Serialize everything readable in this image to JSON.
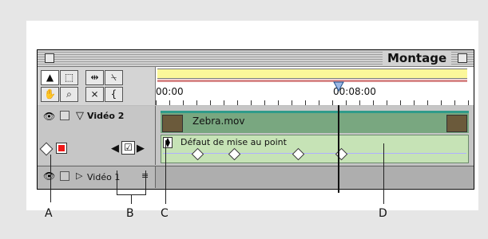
{
  "window": {
    "title": "Montage"
  },
  "timecodes": {
    "start": "00:00",
    "mark": "00:08:00"
  },
  "tools": [
    {
      "name": "selection-tool",
      "glyph": "▲"
    },
    {
      "name": "range-select-tool",
      "glyph": "⬚"
    },
    {
      "name": "track-select-tool",
      "glyph": "⇹"
    },
    {
      "name": "razor-tool",
      "glyph": "⍀"
    },
    {
      "name": "hand-tool",
      "glyph": "✋"
    },
    {
      "name": "zoom-tool",
      "glyph": "⌕"
    },
    {
      "name": "link-tool",
      "glyph": "⨯"
    },
    {
      "name": "in-out-tool",
      "glyph": "{"
    }
  ],
  "tracks": {
    "video2": {
      "name": "Vidéo 2",
      "clip_name": "Zebra.mov",
      "effect_label": "Défaut de mise au point"
    },
    "video1": {
      "name": "Vidéo 1"
    }
  },
  "callouts": [
    "A",
    "B",
    "C",
    "D"
  ],
  "colors": {
    "yellow_bar": "#fbf79a",
    "clip_green": "#79a780",
    "keyframe_band": "#c6e3b6"
  }
}
